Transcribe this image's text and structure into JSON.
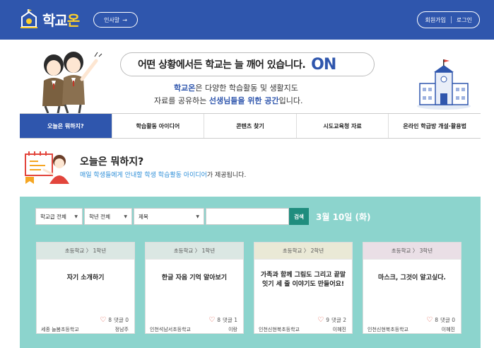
{
  "header": {
    "logo_text_a": "학교",
    "logo_text_b": "온",
    "greet_label": "인사말",
    "greet_arrow": "→",
    "signup_label": "회원가입",
    "login_label": "로그인",
    "bg_color": "#2f56ad"
  },
  "hero": {
    "headline": "어떤 상황에서든 학교는 늘 깨어 있습니다.",
    "headline_on": "ON",
    "line1_hl": "학교온",
    "line1_rest": "은 다양한 학습활동 및 생활지도",
    "line2_pre": "자료를 공유하는 ",
    "line2_hl": "선생님들을 위한 공간",
    "line2_post": "입니다."
  },
  "nav": {
    "items": [
      {
        "label": "오늘은 뭐하지?",
        "active": true
      },
      {
        "label": "학습활동 아이디어",
        "active": false
      },
      {
        "label": "콘텐츠 찾기",
        "active": false
      },
      {
        "label": "시도교육청 자료",
        "active": false
      },
      {
        "label": "온라인 학급방 개설·활용법",
        "active": false
      }
    ]
  },
  "section": {
    "title": "오늘은 뭐하지?",
    "desc_hl": "매일 학생들에게 안내할 학생 학습활동 아이디어",
    "desc_rest": "가 제공됩니다."
  },
  "filters": {
    "school_level": "학교급 전체",
    "grade": "학년 전체",
    "field": "제목",
    "search_label": "검색",
    "date": "3월 10일 (화)"
  },
  "cards": [
    {
      "head": "초등학교 〉 1학년",
      "title": "자기 소개하기",
      "likes": "8",
      "comments": "댓글 0",
      "school": "세종 늘봄초등학교",
      "author": "정남주",
      "head_bg": "#dbe7e3"
    },
    {
      "head": "초등학교 〉 1학년",
      "title": "한글 자음 기억 알아보기",
      "likes": "8",
      "comments": "댓글 1",
      "school": "인천석남서초등학교",
      "author": "이랑",
      "head_bg": "#dbe7e3"
    },
    {
      "head": "초등학교 〉 2학년",
      "title": "가족과 함께 그림도 그리고 끝말잇기 세 줄 이야기도 만들어요!",
      "likes": "9",
      "comments": "댓글 2",
      "school": "인천신현북초등학교",
      "author": "이혜진",
      "head_bg": "#eae9d6"
    },
    {
      "head": "초등학교 〉 3학년",
      "title": "마스크, 그것이 알고싶다.",
      "likes": "8",
      "comments": "댓글 0",
      "school": "인천신현북초등학교",
      "author": "이혜진",
      "head_bg": "#eadfe6"
    }
  ]
}
